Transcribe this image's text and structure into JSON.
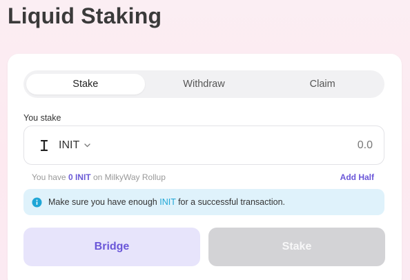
{
  "page": {
    "title": "Liquid Staking"
  },
  "tabs": [
    {
      "label": "Stake",
      "active": true
    },
    {
      "label": "Withdraw",
      "active": false
    },
    {
      "label": "Claim",
      "active": false
    }
  ],
  "stake_form": {
    "label": "You stake",
    "token": {
      "symbol": "INIT",
      "icon": "init-token-icon"
    },
    "amount_placeholder": "0.0",
    "balance": {
      "prefix": "You have ",
      "amount": "0 INIT",
      "suffix": " on MilkyWay Rollup"
    },
    "add_half_label": "Add Half"
  },
  "notice": {
    "icon": "info-icon",
    "text_before": "Make sure you have enough ",
    "highlight": "INIT",
    "text_after": " for a successful transaction."
  },
  "actions": {
    "bridge_label": "Bridge",
    "stake_label": "Stake",
    "stake_disabled": true
  },
  "colors": {
    "accent": "#6a56d8",
    "info_bg": "#dff2fb",
    "info_accent": "#1fa6d6",
    "disabled_button": "#d3d3d6"
  }
}
